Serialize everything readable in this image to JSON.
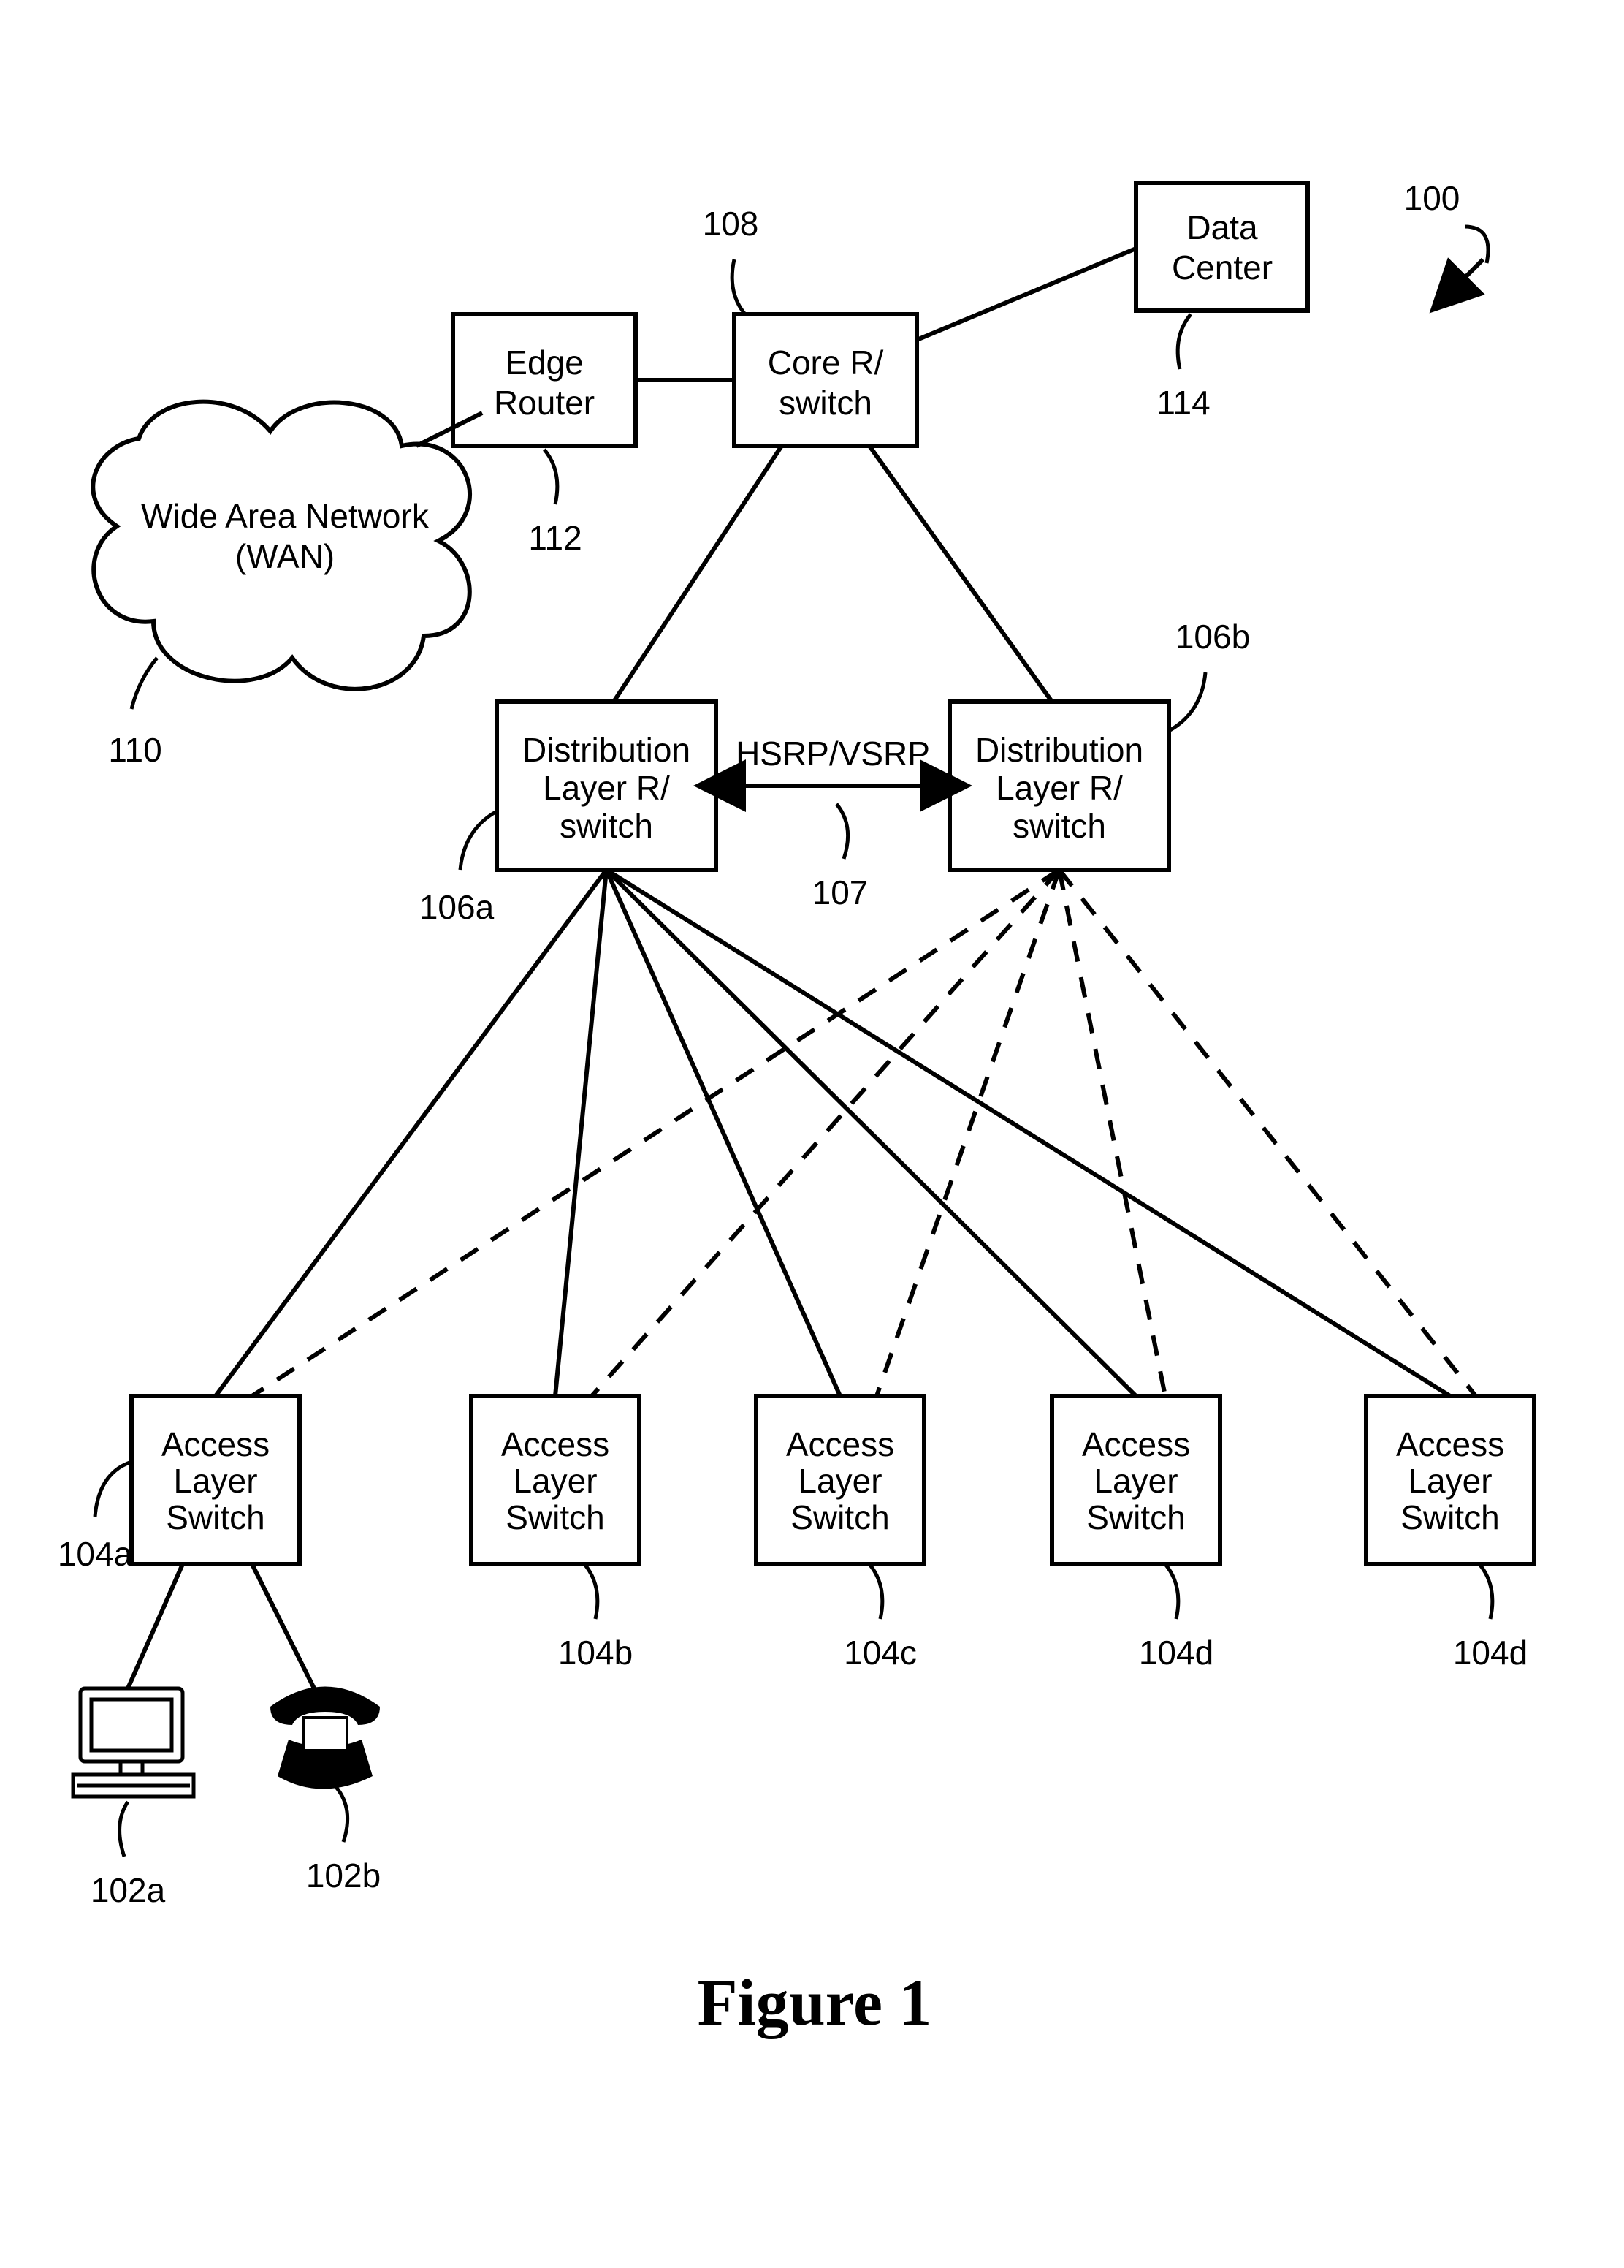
{
  "figure_ref": "100",
  "figure_label": "Figure 1",
  "nodes": {
    "wan": {
      "label_line1": "Wide Area Network",
      "label_line2": "(WAN)",
      "ref": "110"
    },
    "edge": {
      "label_line1": "Edge",
      "label_line2": "Router",
      "ref": "112"
    },
    "core": {
      "label_line1": "Core R/",
      "label_line2": "switch",
      "ref": "108"
    },
    "dc": {
      "label_line1": "Data",
      "label_line2": "Center",
      "ref": "114"
    },
    "dist_a": {
      "label_line1": "Distribution",
      "label_line2": "Layer R/",
      "label_line3": "switch",
      "ref": "106a"
    },
    "dist_b": {
      "label_line1": "Distribution",
      "label_line2": "Layer R/",
      "label_line3": "switch",
      "ref": "106b"
    },
    "dist_link": {
      "label": "HSRP/VSRP",
      "ref": "107"
    },
    "access_1": {
      "label_line1": "Access",
      "label_line2": "Layer",
      "label_line3": "Switch",
      "ref": "104a"
    },
    "access_2": {
      "label_line1": "Access",
      "label_line2": "Layer",
      "label_line3": "Switch",
      "ref": "104b"
    },
    "access_3": {
      "label_line1": "Access",
      "label_line2": "Layer",
      "label_line3": "Switch",
      "ref": "104c"
    },
    "access_4": {
      "label_line1": "Access",
      "label_line2": "Layer",
      "label_line3": "Switch",
      "ref": "104d"
    },
    "access_5": {
      "label_line1": "Access",
      "label_line2": "Layer",
      "label_line3": "Switch",
      "ref": "104d"
    },
    "device_a": {
      "ref": "102a"
    },
    "device_b": {
      "ref": "102b"
    }
  }
}
